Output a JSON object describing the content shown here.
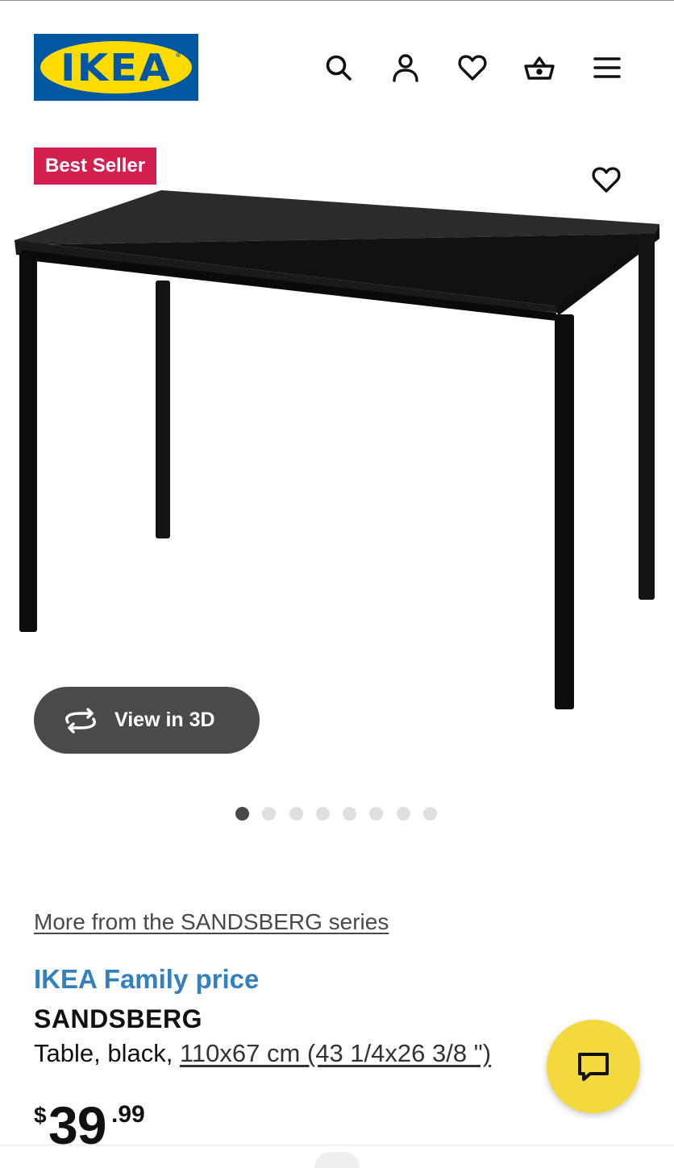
{
  "header": {
    "logo_text": "IKEA",
    "logo_reg": "®",
    "icons": [
      "search-icon",
      "account-icon",
      "heart-icon",
      "cart-icon",
      "menu-icon"
    ]
  },
  "product": {
    "badge": "Best Seller",
    "view_3d_label": "View in 3D",
    "gallery": {
      "total_images": 8,
      "current_index": 1
    },
    "series_link": "More from the SANDSBERG series",
    "price_label": "IKEA Family price",
    "name": "SANDSBERG",
    "description_prefix": "Table, black, ",
    "size_link": "110x67 cm (43 1/4x26 3/8 \")",
    "price": {
      "currency": "$",
      "integer": "39",
      "decimal": ".99"
    }
  },
  "colors": {
    "ikea_blue": "#0058a3",
    "ikea_yellow": "#ffdb00",
    "badge_red": "#d31f4f",
    "family_blue": "#3280c0",
    "chat_yellow": "#f3d93e",
    "view3d_bg": "#4a4a4a"
  }
}
